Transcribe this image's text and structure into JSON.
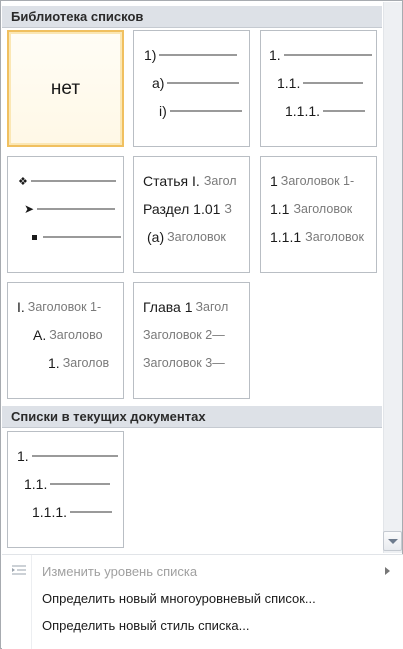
{
  "library": {
    "header": "Библиотека списков",
    "none_label": "нет",
    "tile_num": {
      "l1": "1)",
      "l2": "a)",
      "l3": "i)"
    },
    "tile_decimal": {
      "l1": "1.",
      "l2": "1.1.",
      "l3": "1.1.1."
    },
    "tile_bullets": {
      "b1_icon": "diamond-bullet",
      "b2_icon": "arrowhead-bullet",
      "b3_icon": "square-bullet"
    },
    "tile_article": {
      "l1_mark": "Статья I.",
      "l1_text": "Загол",
      "l2_mark": "Раздел 1.01",
      "l2_text": "З",
      "l3_mark": "(a)",
      "l3_text": "Заголовок"
    },
    "tile_heading_numbered": {
      "l1_mark": "1",
      "l1_text": "Заголовок 1-",
      "l2_mark": "1.1",
      "l2_text": "Заголовок",
      "l3_mark": "1.1.1",
      "l3_text": "Заголовок"
    },
    "tile_roman": {
      "l1_mark": "I.",
      "l1_text": "Заголовок 1-",
      "l2_mark": "A.",
      "l2_text": "Заголово",
      "l3_mark": "1.",
      "l3_text": "Заголов"
    },
    "tile_chapter": {
      "l1_mark": "Глава 1",
      "l1_text": "Загол",
      "l2_text": "Заголовок 2—",
      "l3_text": "Заголовок 3—"
    }
  },
  "current": {
    "header": "Списки в текущих документах",
    "tile": {
      "l1": "1.",
      "l2": "1.1.",
      "l3": "1.1.1."
    }
  },
  "menu": {
    "change_level": "Изменить уровень списка",
    "define_multilevel": "Определить новый многоуровневый список...",
    "define_style": "Определить новый стиль списка..."
  }
}
